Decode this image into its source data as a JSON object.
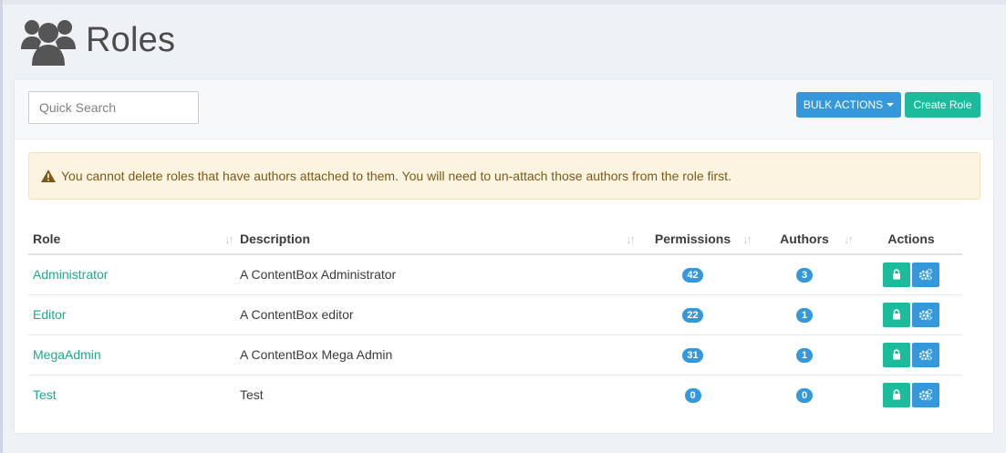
{
  "page": {
    "title": "Roles",
    "header_icon": "users-icon"
  },
  "toolbar": {
    "search_placeholder": "Quick Search",
    "bulk_actions_label": "BULK ACTIONS",
    "create_role_label": "Create Role"
  },
  "alert": {
    "icon": "warning-icon",
    "message": "You cannot delete roles that have authors attached to them. You will need to un-attach those authors from the role first."
  },
  "table": {
    "columns": {
      "role": "Role",
      "description": "Description",
      "permissions": "Permissions",
      "authors": "Authors",
      "actions": "Actions"
    },
    "rows": [
      {
        "role": "Administrator",
        "description": "A ContentBox Administrator",
        "permissions": "42",
        "authors": "3"
      },
      {
        "role": "Editor",
        "description": "A ContentBox editor",
        "permissions": "22",
        "authors": "1"
      },
      {
        "role": "MegaAdmin",
        "description": "A ContentBox Mega Admin",
        "permissions": "31",
        "authors": "1"
      },
      {
        "role": "Test",
        "description": "Test",
        "permissions": "0",
        "authors": "0"
      }
    ]
  },
  "colors": {
    "accent_green": "#1abc9c",
    "accent_blue": "#3498db",
    "alert_bg": "#fcf4e0",
    "link": "#1aa98a"
  }
}
